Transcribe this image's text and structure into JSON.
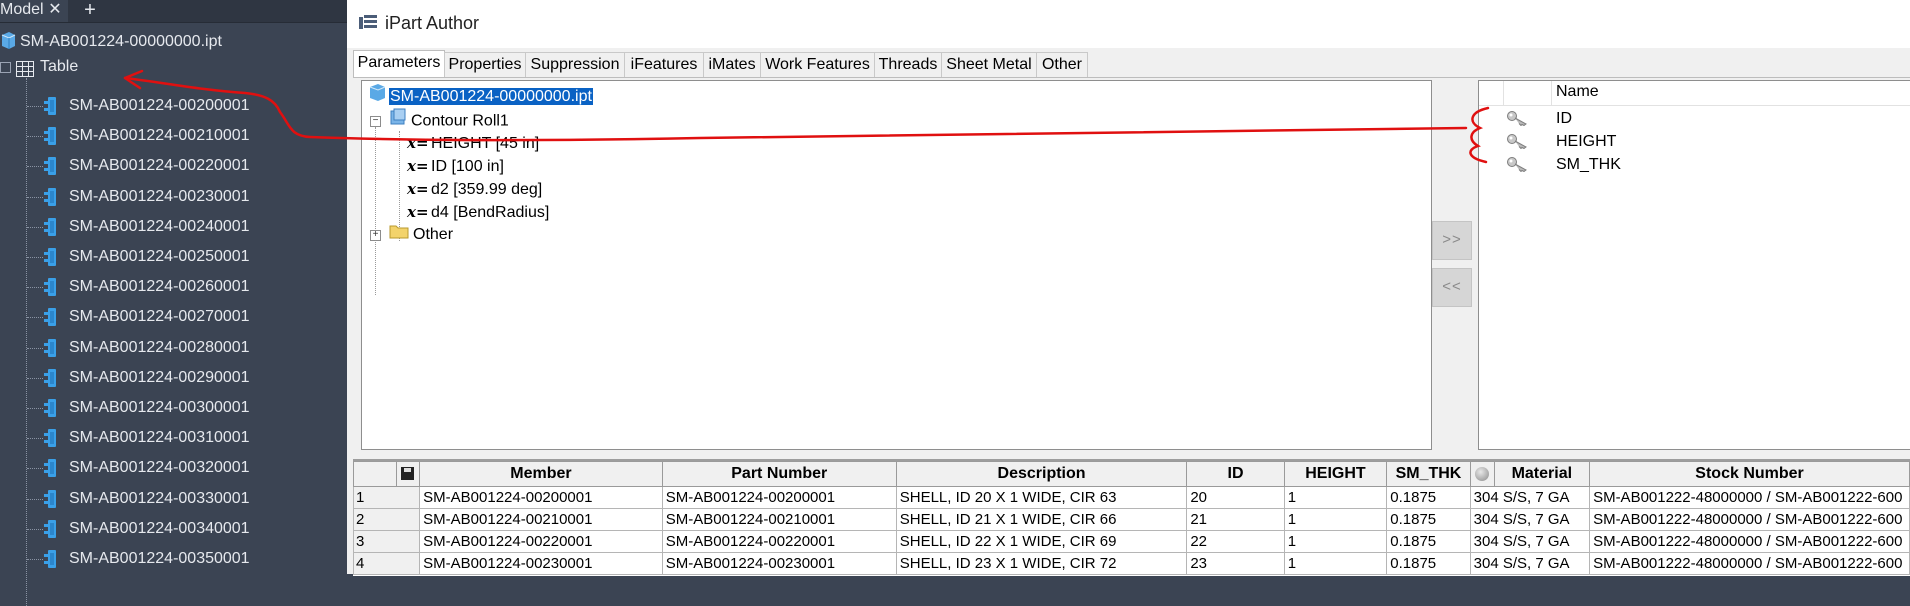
{
  "browser": {
    "tab_label": "Model",
    "close_glyph": "✕",
    "add_glyph": "+",
    "root_file": "SM-AB001224-00000000.ipt",
    "table_label": "Table",
    "members": [
      "SM-AB001224-00200001",
      "SM-AB001224-00210001",
      "SM-AB001224-00220001",
      "SM-AB001224-00230001",
      "SM-AB001224-00240001",
      "SM-AB001224-00250001",
      "SM-AB001224-00260001",
      "SM-AB001224-00270001",
      "SM-AB001224-00280001",
      "SM-AB001224-00290001",
      "SM-AB001224-00300001",
      "SM-AB001224-00310001",
      "SM-AB001224-00320001",
      "SM-AB001224-00330001",
      "SM-AB001224-00340001",
      "SM-AB001224-00350001"
    ]
  },
  "dialog": {
    "title": "iPart Author",
    "tabs": [
      "Parameters",
      "Properties",
      "Suppression",
      "iFeatures",
      "iMates",
      "Work Features",
      "Threads",
      "Sheet Metal",
      "Other"
    ],
    "active_tab": "Parameters",
    "tree": {
      "root": "SM-AB001224-00000000.ipt",
      "feature": "Contour Roll1",
      "params": [
        "HEIGHT [45 in]",
        "ID [100 in]",
        "d2 [359.99 deg]",
        "d4 [BendRadius]"
      ],
      "other": "Other"
    },
    "add_button": ">>",
    "remove_button": "<<",
    "keys": {
      "header": "Name",
      "items": [
        "ID",
        "HEIGHT",
        "SM_THK"
      ]
    }
  },
  "grid": {
    "columns": [
      "",
      "",
      "Member",
      "Part Number",
      "Description",
      "ID",
      "HEIGHT",
      "SM_THK",
      "",
      "Material",
      "Stock Number"
    ],
    "rows": [
      [
        "1",
        "SM-AB001224-00200001",
        "SM-AB001224-00200001",
        "SHELL, ID 20 X 1 WIDE, CIR 63",
        "20",
        "1",
        "0.1875",
        "304 S/S, 7 GA",
        "SM-AB001222-48000000 / SM-AB001222-600"
      ],
      [
        "2",
        "SM-AB001224-00210001",
        "SM-AB001224-00210001",
        "SHELL, ID 21 X 1 WIDE, CIR 66",
        "21",
        "1",
        "0.1875",
        "304 S/S, 7 GA",
        "SM-AB001222-48000000 / SM-AB001222-600"
      ],
      [
        "3",
        "SM-AB001224-00220001",
        "SM-AB001224-00220001",
        "SHELL, ID 22 X 1 WIDE, CIR 69",
        "22",
        "1",
        "0.1875",
        "304 S/S, 7 GA",
        "SM-AB001222-48000000 / SM-AB001222-600"
      ],
      [
        "4",
        "SM-AB001224-00230001",
        "SM-AB001224-00230001",
        "SHELL, ID 23 X 1 WIDE, CIR 72",
        "23",
        "1",
        "0.1875",
        "304 S/S, 7 GA",
        "SM-AB001222-48000000 / SM-AB001222-600"
      ]
    ]
  },
  "colors": {
    "browser_bg": "#3b4453",
    "selection": "#0a62c4",
    "annotation": "#e01010",
    "part_icon": "#3aa0e8"
  }
}
